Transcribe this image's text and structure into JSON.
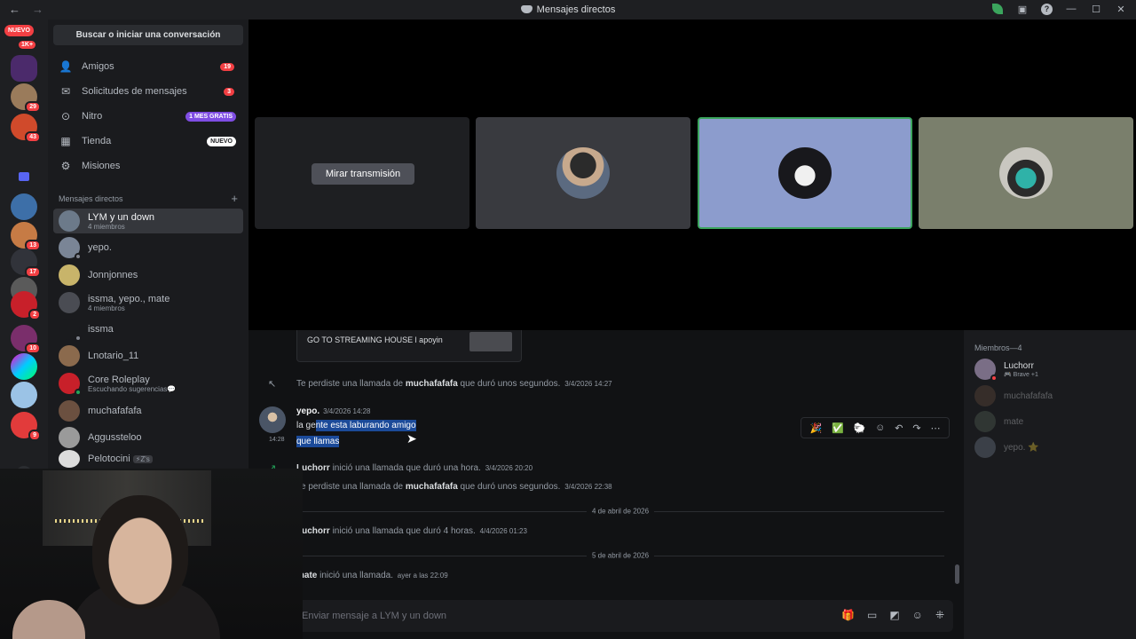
{
  "titlebar": {
    "title": "Mensajes directos",
    "back_icon": "←",
    "forward_icon": "→",
    "icons": [
      "leaf-icon",
      "screen-icon",
      "help-icon",
      "minimize-icon",
      "maximize-icon",
      "close-icon"
    ]
  },
  "servers": {
    "nuevo_label": "NUEVO",
    "nuevo_count": "1K+",
    "badges": [
      "29",
      "43",
      "13",
      "17",
      "2",
      "10",
      "9"
    ]
  },
  "dm_panel": {
    "search_label": "Buscar o iniciar una conversación",
    "nav": [
      {
        "label": "Amigos",
        "badge": "19"
      },
      {
        "label": "Solicitudes de mensajes",
        "badge": "3"
      },
      {
        "label": "Nitro",
        "tag": "1 MES GRATIS"
      },
      {
        "label": "Tienda",
        "tag": "NUEVO"
      },
      {
        "label": "Misiones"
      }
    ],
    "section_title": "Mensajes directos",
    "conversations": [
      {
        "name": "LYM y un down",
        "sub": "4 miembros"
      },
      {
        "name": "yepo."
      },
      {
        "name": "Jonnjonnes"
      },
      {
        "name": "issma, yepo., mate",
        "sub": "4 miembros"
      },
      {
        "name": "issma"
      },
      {
        "name": "Lnotario_11"
      },
      {
        "name": "Core Roleplay",
        "sub": "Escuchando sugerencias💬"
      },
      {
        "name": "muchafafafa"
      },
      {
        "name": "Aggussteloo"
      },
      {
        "name": "Pelotocini",
        "sub": "⚡Z's"
      }
    ]
  },
  "stage": {
    "watch_label": "Mirar transmisión"
  },
  "chat": {
    "embed_title": "GO TO STREAMING HOUSE l apoyin",
    "missed1": {
      "prefix": "Te perdiste una llamada de",
      "name": "muchafafafa",
      "suffix": "que duró unos segundos.",
      "ts": "3/4/2026 14:27"
    },
    "message": {
      "author": "yepo.",
      "ts": "3/4/2026 14:28",
      "hover_ts": "14:28",
      "line1_plain": "la ge",
      "line1_sel": "nte esta laburando amigo",
      "line2_sel": "que llamas"
    },
    "call1": {
      "name": "Luchorr",
      "suffix": "inició una llamada que duró una hora.",
      "ts": "3/4/2026 20:20"
    },
    "missed2": {
      "prefix": "Te perdiste una llamada de",
      "name": "muchafafafa",
      "suffix": "que duró unos segundos.",
      "ts": "3/4/2026 22:38"
    },
    "date1": "4 de abril de 2026",
    "call2": {
      "name": "Luchorr",
      "suffix": "inició una llamada que duró 4 horas.",
      "ts": "4/4/2026 01:23"
    },
    "date2": "5 de abril de 2026",
    "call3": {
      "name": "mate",
      "suffix": "inició una llamada.",
      "ts": "ayer a las 22:09"
    },
    "composer_placeholder": "Enviar mensaje a LYM y un down",
    "toolbar_icons": [
      "🎉",
      "✅",
      "🐑",
      "☺",
      "↶",
      "↷",
      "⋯"
    ],
    "composer_icons": [
      "gift-icon",
      "gif-icon",
      "sticker-icon",
      "emoji-icon",
      "apps-icon"
    ]
  },
  "members": {
    "header": "Miembros—4",
    "list": [
      {
        "name": "Luchorr",
        "activity": "🎮 Brave +1"
      },
      {
        "name": "muchafafafa"
      },
      {
        "name": "mate"
      },
      {
        "name": "yepo. ⭐"
      }
    ]
  }
}
